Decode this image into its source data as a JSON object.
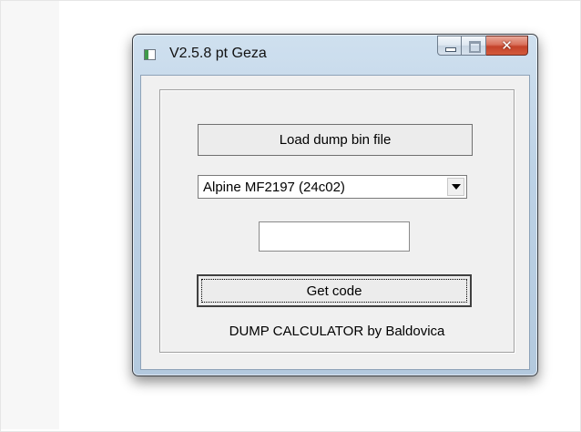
{
  "window": {
    "title": "V2.5.8 pt Geza",
    "controls": {
      "minimize_icon": "minimize-icon",
      "maximize_icon": "maximize-icon",
      "close_icon": "close-icon",
      "close_glyph": "✕"
    }
  },
  "main": {
    "load_button_label": "Load dump bin file",
    "model_select": {
      "selected": "Alpine MF2197  (24c02)"
    },
    "code_field": {
      "value": ""
    },
    "get_code_button_label": "Get code",
    "footer_text": "DUMP CALCULATOR by Baldovica"
  },
  "colors": {
    "titlebar": "#bdd2e6",
    "close_button": "#c4432a",
    "client_background": "#f0f0f0"
  }
}
